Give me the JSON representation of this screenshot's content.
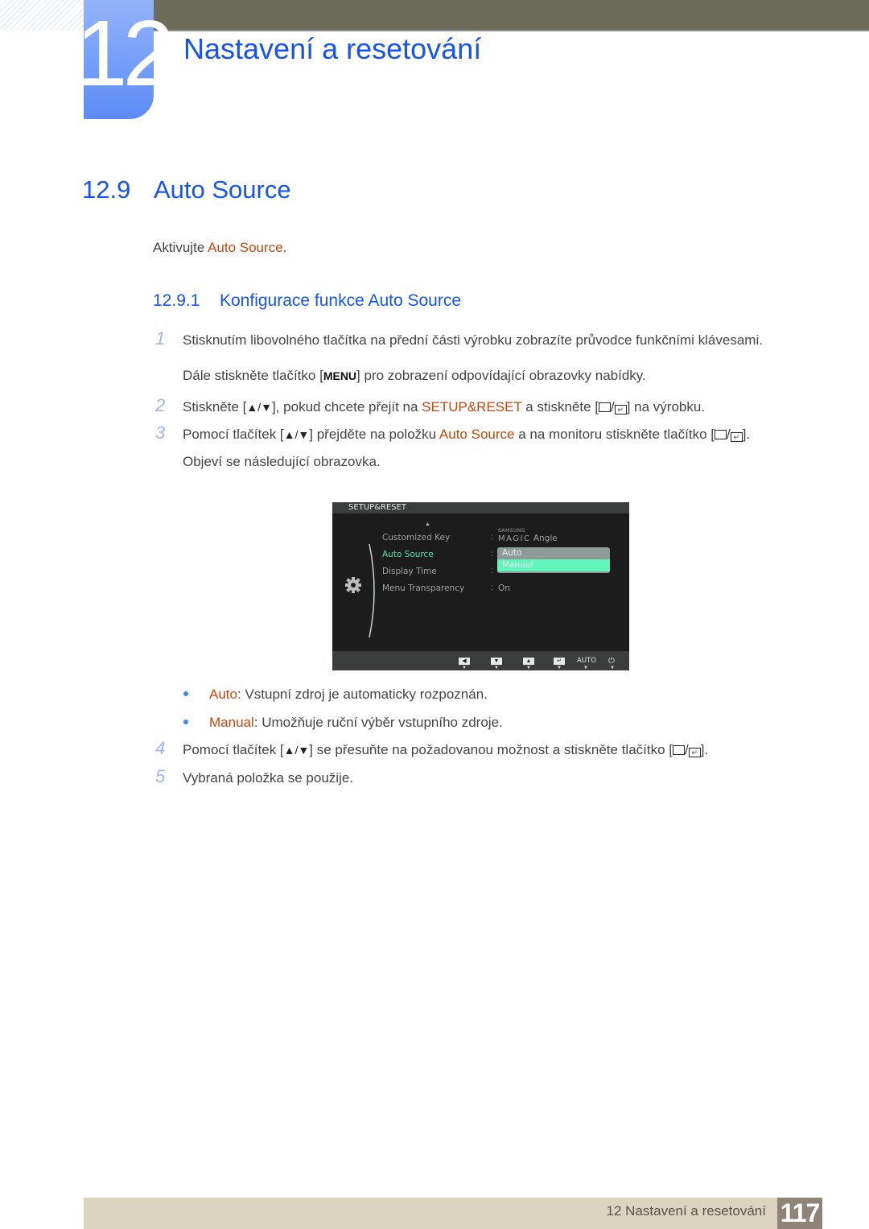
{
  "header": {
    "chapter_number": "12",
    "chapter_title": "Nastavení a resetování"
  },
  "section": {
    "number": "12.9",
    "title": "Auto Source",
    "intro_prefix": "Aktivujte ",
    "intro_highlight": "Auto Source",
    "intro_suffix": "."
  },
  "subsection": {
    "number": "12.9.1",
    "title": "Konfigurace funkce Auto Source"
  },
  "steps": [
    {
      "number": "1",
      "line1": "Stisknutím libovolného tlačítka na přední části výrobku zobrazíte průvodce funkčními klávesami.",
      "line2_prefix": "Dále stiskněte tlačítko [",
      "line2_key": "MENU",
      "line2_suffix": "] pro zobrazení odpovídající obrazovky nabídky."
    },
    {
      "number": "2",
      "part1": "Stiskněte [",
      "part2": "], pokud chcete přejít na ",
      "highlight": "SETUP&RESET",
      "part3": " a stiskněte [",
      "part4": "] na výrobku."
    },
    {
      "number": "3",
      "part1": "Pomocí tlačítek [",
      "part2": "] přejděte na položku ",
      "highlight": "Auto Source",
      "part3": " a na monitoru stiskněte tlačítko [",
      "part4": "].",
      "line2": "Objeví se následující obrazovka."
    },
    {
      "number": "4",
      "part1": "Pomocí tlačítek [",
      "part2": "] se přesuňte na požadovanou možnost a stiskněte tlačítko [",
      "part3": "]."
    },
    {
      "number": "5",
      "text": "Vybraná položka se použije."
    }
  ],
  "bullets": [
    {
      "term": "Auto",
      "desc": ": Vstupní zdroj je automaticky rozpoznán."
    },
    {
      "term": "Manual",
      "desc": ": Umožňuje ruční výběr vstupního zdroje."
    }
  ],
  "osd": {
    "title": "SETUP&RESET",
    "menu_items": [
      {
        "label": "Customized Key",
        "value_small": "SAMSUNG",
        "value_big": "MAGIC",
        "value_suffix": "Angle"
      },
      {
        "label": "Auto Source",
        "active": true
      },
      {
        "label": "Display Time"
      },
      {
        "label": "Menu Transparency",
        "value": "On"
      }
    ],
    "dropdown_options": [
      {
        "label": "Auto",
        "selected": false
      },
      {
        "label": "Manual",
        "selected": true
      }
    ],
    "buttons": [
      "left",
      "down",
      "up",
      "enter",
      "AUTO",
      "power"
    ],
    "auto_label": "AUTO",
    "colors": {
      "active": "#5ee3b0",
      "selected_option": "#5ff5bd"
    }
  },
  "icons": {
    "up_down": "▲/▼",
    "source_enter": "source-enter-icon"
  },
  "footer": {
    "chapter_label": "12 Nastavení a resetování",
    "page_number": "117"
  },
  "colors": {
    "heading_blue": "#1553f5",
    "highlight_orange": "#c8460c",
    "step_number": "#9db5f6",
    "top_bar": "#6d6c58",
    "footer_bg": "#dbd4c1",
    "page_box": "#8f8478"
  }
}
